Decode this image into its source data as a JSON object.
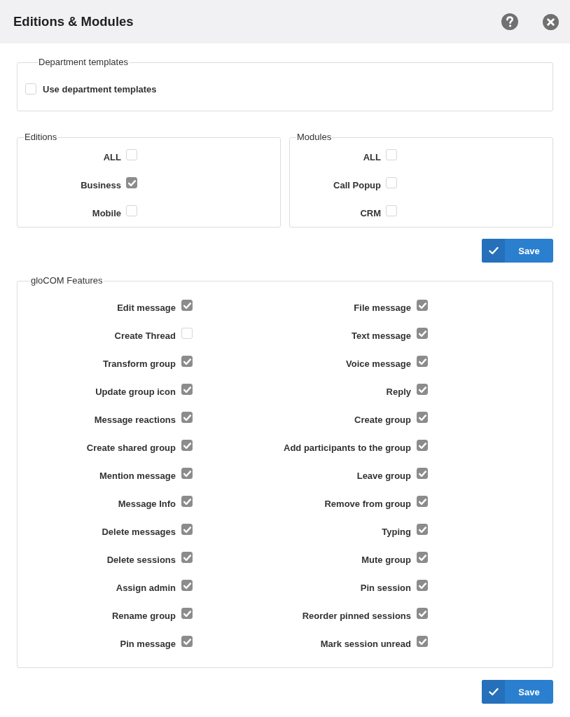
{
  "header": {
    "title": "Editions & Modules"
  },
  "department_templates": {
    "legend": "Department templates",
    "options": [
      {
        "label": "Use department templates",
        "checked": false
      }
    ]
  },
  "editions": {
    "legend": "Editions",
    "options": [
      {
        "label": "ALL",
        "checked": false
      },
      {
        "label": "Business",
        "checked": true
      },
      {
        "label": "Mobile",
        "checked": false
      }
    ]
  },
  "modules": {
    "legend": "Modules",
    "options": [
      {
        "label": "ALL",
        "checked": false
      },
      {
        "label": "Call Popup",
        "checked": false
      },
      {
        "label": "CRM",
        "checked": false
      }
    ]
  },
  "editions_save": {
    "label": "Save"
  },
  "features": {
    "legend": "gloCOM Features",
    "items": [
      {
        "label": "Edit message",
        "checked": true
      },
      {
        "label": "File message",
        "checked": true
      },
      {
        "label": "Create Thread",
        "checked": false
      },
      {
        "label": "Text message",
        "checked": true
      },
      {
        "label": "Transform group",
        "checked": true
      },
      {
        "label": "Voice message",
        "checked": true
      },
      {
        "label": "Update group icon",
        "checked": true
      },
      {
        "label": "Reply",
        "checked": true
      },
      {
        "label": "Message reactions",
        "checked": true
      },
      {
        "label": "Create group",
        "checked": true
      },
      {
        "label": "Create shared group",
        "checked": true
      },
      {
        "label": "Add participants to the group",
        "checked": true
      },
      {
        "label": "Mention message",
        "checked": true
      },
      {
        "label": "Leave group",
        "checked": true
      },
      {
        "label": "Message Info",
        "checked": true
      },
      {
        "label": "Remove from group",
        "checked": true
      },
      {
        "label": "Delete messages",
        "checked": true
      },
      {
        "label": "Typing",
        "checked": true
      },
      {
        "label": "Delete sessions",
        "checked": true
      },
      {
        "label": "Mute group",
        "checked": true
      },
      {
        "label": "Assign admin",
        "checked": true
      },
      {
        "label": "Pin session",
        "checked": true
      },
      {
        "label": "Rename group",
        "checked": true
      },
      {
        "label": "Reorder pinned sessions",
        "checked": true
      },
      {
        "label": "Pin message",
        "checked": true
      },
      {
        "label": "Mark session unread",
        "checked": true
      }
    ]
  },
  "features_save": {
    "label": "Save"
  }
}
